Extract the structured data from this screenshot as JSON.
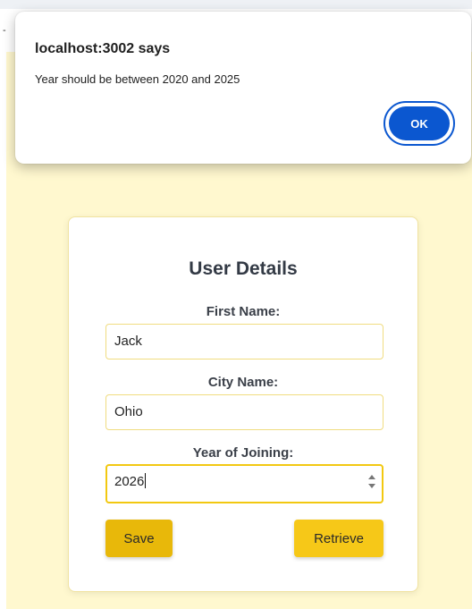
{
  "alert": {
    "title": "localhost:3002 says",
    "message": "Year should be between 2020 and 2025",
    "ok_label": "OK"
  },
  "page": {
    "edge_mark": "-"
  },
  "form": {
    "title": "User Details",
    "fields": [
      {
        "label": "First Name:",
        "value": "Jack"
      },
      {
        "label": "City Name:",
        "value": "Ohio"
      },
      {
        "label": "Year of Joining:",
        "value": "2026"
      }
    ],
    "save_label": "Save",
    "retrieve_label": "Retrieve"
  },
  "colors": {
    "page_background": "#fff8cf",
    "accent_yellow": "#f6c818",
    "save_button": "#e8b80a",
    "dialog_button_blue": "#0b57d0"
  }
}
